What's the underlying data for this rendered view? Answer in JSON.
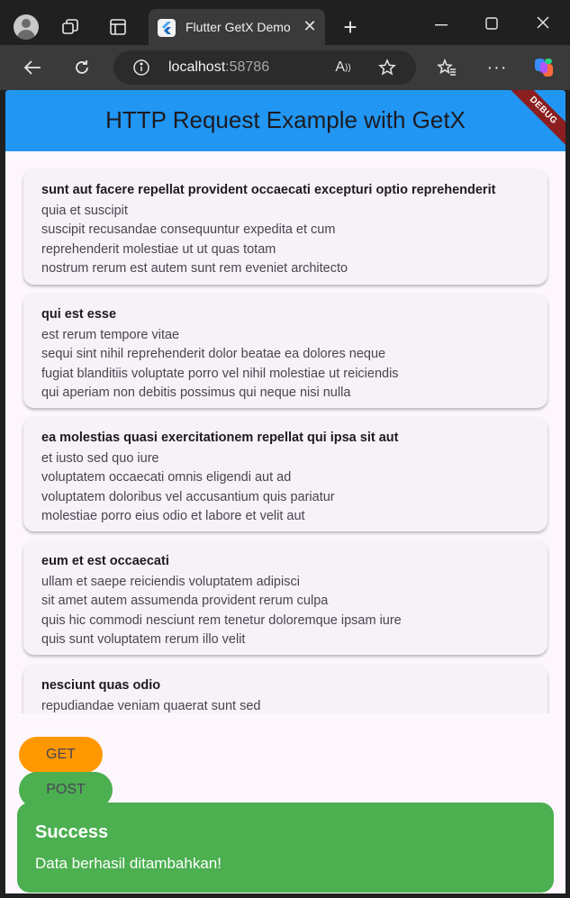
{
  "browser": {
    "tab_title": "Flutter GetX Demo",
    "url_host": "localhost",
    "url_port": ":58786"
  },
  "app": {
    "title": "HTTP Request Example with GetX",
    "debug_banner": "DEBUG"
  },
  "posts": [
    {
      "title": "sunt aut facere repellat provident occaecati excepturi optio reprehenderit",
      "lines": [
        "quia et suscipit",
        "suscipit recusandae consequuntur expedita et cum",
        "reprehenderit molestiae ut ut quas totam",
        "nostrum rerum est autem sunt rem eveniet architecto"
      ]
    },
    {
      "title": "qui est esse",
      "lines": [
        "est rerum tempore vitae",
        "sequi sint nihil reprehenderit dolor beatae ea dolores neque",
        "fugiat blanditiis voluptate porro vel nihil molestiae ut reiciendis",
        "qui aperiam non debitis possimus qui neque nisi nulla"
      ]
    },
    {
      "title": "ea molestias quasi exercitationem repellat qui ipsa sit aut",
      "lines": [
        "et iusto sed quo iure",
        "voluptatem occaecati omnis eligendi aut ad",
        "voluptatem doloribus vel accusantium quis pariatur",
        "molestiae porro eius odio et labore et velit aut"
      ]
    },
    {
      "title": "eum et est occaecati",
      "lines": [
        "ullam et saepe reiciendis voluptatem adipisci",
        "sit amet autem assumenda provident rerum culpa",
        "quis hic commodi nesciunt rem tenetur doloremque ipsam iure",
        "quis sunt voluptatem rerum illo velit"
      ]
    },
    {
      "title": "nesciunt quas odio",
      "lines": [
        "repudiandae veniam quaerat sunt sed"
      ]
    }
  ],
  "buttons": {
    "get": "GET",
    "post": "POST"
  },
  "snackbar": {
    "title": "Success",
    "message": "Data berhasil ditambahkan!"
  },
  "colors": {
    "appbar": "#2196f3",
    "get_button": "#ff9800",
    "post_button": "#4caf50",
    "snackbar": "#4caf50"
  }
}
